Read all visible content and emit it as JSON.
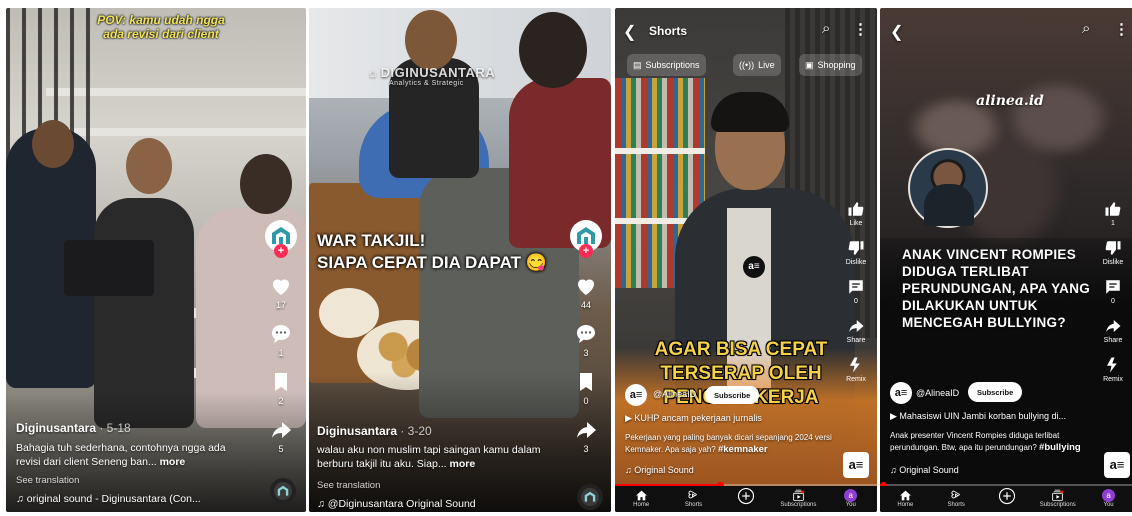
{
  "colors": {
    "tiktok_red": "#fe2c55",
    "youtube_red": "#ff0000",
    "caption_yellow": "#f2e45a",
    "alinea_teal": "#2f7f85"
  },
  "panel1": {
    "overlay_line1": "POV: kamu udah ngga",
    "overlay_line2": "ada revisi dari client",
    "like_count": "17",
    "comment_count": "1",
    "save_count": "2",
    "share_count": "5",
    "author": "Diginusantara",
    "date": " · 5-18",
    "description": "Bahagia tuh sederhana, contohnya ngga ada revisi dari client Seneng ban...",
    "more": "more",
    "see_translation": "See translation",
    "sound": "original sound - Diginusantara (Con..."
  },
  "panel2": {
    "watermark": "DIGINUSANTARA",
    "watermark_sub": "Analytics & Strategic",
    "overlay_line1": "WAR TAKJIL!",
    "overlay_line2": "SIAPA CEPAT DIA DAPAT",
    "like_count": "44",
    "comment_count": "3",
    "save_count": "0",
    "share_count": "3",
    "author": "Diginusantara",
    "date": " · 3-20",
    "description": "walau aku non muslim tapi saingan kamu dalam berburu takjil itu aku. Siap...",
    "more": "more",
    "see_translation": "See translation",
    "sound": "@Diginusantara Original Sound"
  },
  "panel3": {
    "title": "Shorts",
    "chips": [
      "Subscriptions",
      "Live",
      "Shopping"
    ],
    "like_label": "Like",
    "dislike_label": "Dislike",
    "comment_count": "0",
    "share_label": "Share",
    "remix_label": "Remix",
    "caption_line1": "AGAR BISA CEPAT",
    "caption_line2": "TERSERAP OLEH",
    "caption_line3": "PENCARI KERJA",
    "channel": "@AlineaID",
    "subscribe": "Subscribe",
    "related": "KUHP ancam pekerjaan jurnalis",
    "description": "Pekerjaan yang paling banyak dicari sepanjang 2024 versi Kemnaker. Apa saja yah?",
    "hashtag": "#kemnaker",
    "sound": "Original Sound",
    "nav": [
      "Home",
      "Shorts",
      "",
      "Subscriptions",
      "You"
    ],
    "avatar_letter": "a"
  },
  "panel4": {
    "logo": "alinea.id",
    "headline_line1": "ANAK VINCENT ROMPIES",
    "headline_line2": "DIDUGA TERLIBAT",
    "headline_line3": "PERUNDUNGAN, APA YANG",
    "headline_line4": "DILAKUKAN UNTUK",
    "headline_line5": "MENCEGAH BULLYING?",
    "like_count": "1",
    "dislike_label": "Dislike",
    "comment_count": "0",
    "share_label": "Share",
    "remix_label": "Remix",
    "channel": "@AlineaID",
    "subscribe": "Subscribe",
    "related": "Mahasiswi UIN Jambi korban bullying di...",
    "description": "Anak presenter Vincent Rompies diduga terlibat perundungan. Btw, apa itu perundungan?",
    "hashtag": "#bullying",
    "sound": "Original Sound",
    "nav": [
      "Home",
      "Shorts",
      "",
      "Subscriptions",
      "You"
    ],
    "avatar_letter": "a"
  }
}
